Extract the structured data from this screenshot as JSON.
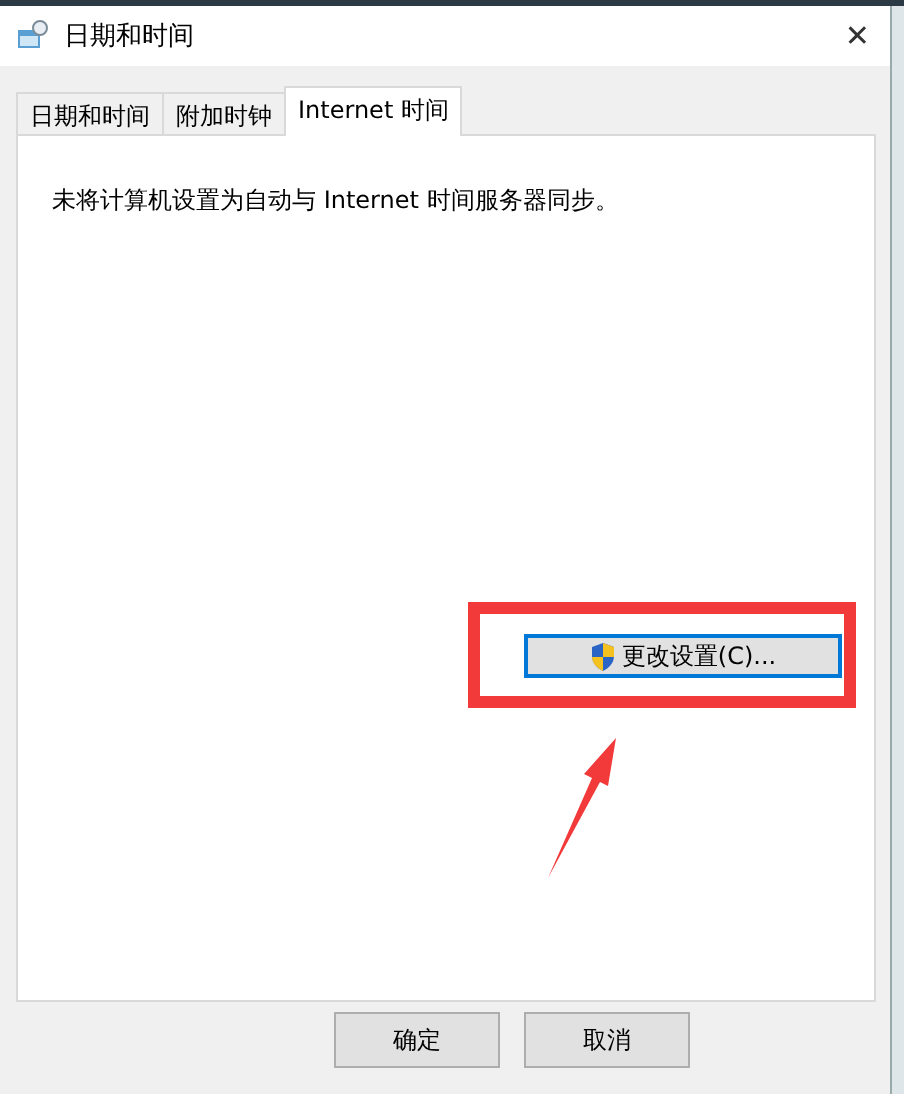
{
  "window": {
    "title": "日期和时间",
    "close": "✕"
  },
  "tabs": [
    {
      "label": "日期和时间",
      "selected": false
    },
    {
      "label": "附加时钟",
      "selected": false
    },
    {
      "label": "Internet 时间",
      "selected": true
    }
  ],
  "message": "未将计算机设置为自动与 Internet 时间服务器同步。",
  "change_button": {
    "label": "更改设置(C)...",
    "focused": true
  },
  "annotation": {
    "kind": "highlight-arrow"
  },
  "buttons": [
    {
      "label": "确定"
    },
    {
      "label": "取消"
    }
  ]
}
